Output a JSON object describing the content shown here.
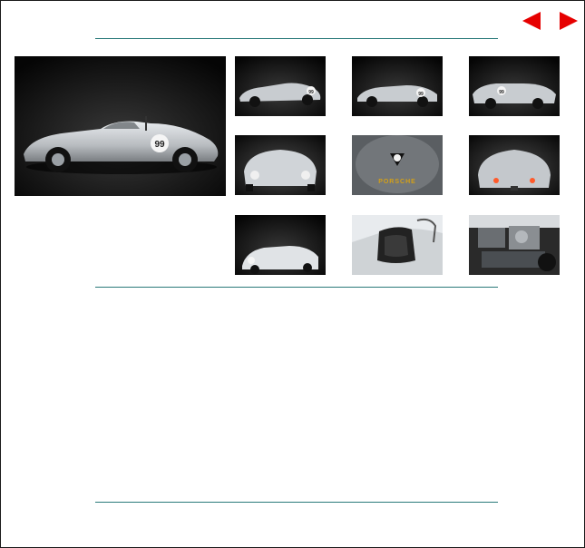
{
  "navigation": {
    "prev_icon": "left-arrow-icon",
    "next_icon": "right-arrow-icon",
    "arrow_color": "#e60000"
  },
  "gallery": {
    "main_photo": {
      "subject": "side-view-race-car",
      "race_number": "99"
    },
    "thumbnails": [
      {
        "subject": "front-three-quarter",
        "race_number": "99"
      },
      {
        "subject": "side-profile",
        "race_number": "99"
      },
      {
        "subject": "rear-three-quarter",
        "race_number": "99"
      },
      {
        "subject": "front-view"
      },
      {
        "subject": "hood-badge",
        "badge_text": "PORSCHE"
      },
      {
        "subject": "rear-view"
      },
      {
        "subject": "low-front-three-quarter"
      },
      {
        "subject": "cockpit-seat"
      },
      {
        "subject": "engine-bay"
      }
    ]
  },
  "colors": {
    "rule": "#2a7a7a",
    "frame_border": "#1a1a1a",
    "photo_background": "#0d0d0d",
    "car_silver": "#c8ccd0"
  }
}
